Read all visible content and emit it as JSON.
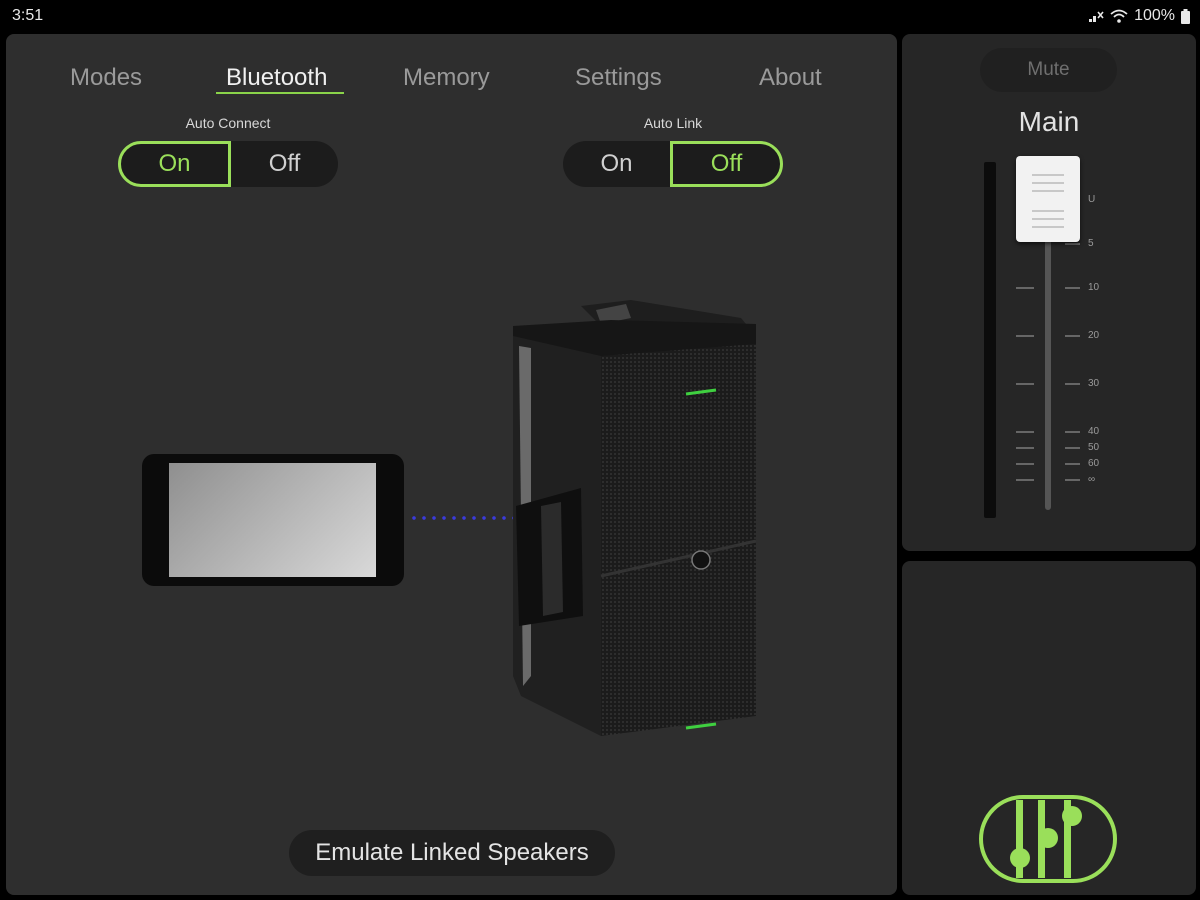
{
  "status_bar": {
    "time": "3:51",
    "battery": "100%"
  },
  "tabs": [
    {
      "label": "Modes",
      "active": false
    },
    {
      "label": "Bluetooth",
      "active": true
    },
    {
      "label": "Memory",
      "active": false
    },
    {
      "label": "Settings",
      "active": false
    },
    {
      "label": "About",
      "active": false
    }
  ],
  "auto_connect": {
    "label": "Auto Connect",
    "on_label": "On",
    "off_label": "Off",
    "selected": "On"
  },
  "auto_link": {
    "label": "Auto Link",
    "on_label": "On",
    "off_label": "Off",
    "selected": "Off"
  },
  "emulate_button": "Emulate Linked Speakers",
  "fader_panel": {
    "mute_label": "Mute",
    "channel_title": "Main",
    "scale_labels": [
      "U",
      "5",
      "10",
      "20",
      "30",
      "40",
      "50",
      "60",
      "∞"
    ]
  },
  "colors": {
    "accent": "#9adf5a",
    "link_line": "#3b3bdc",
    "panel": "#2e2e2e"
  },
  "icons": [
    "signal-mute-icon",
    "wifi-icon",
    "battery-icon",
    "mixer-icon"
  ]
}
